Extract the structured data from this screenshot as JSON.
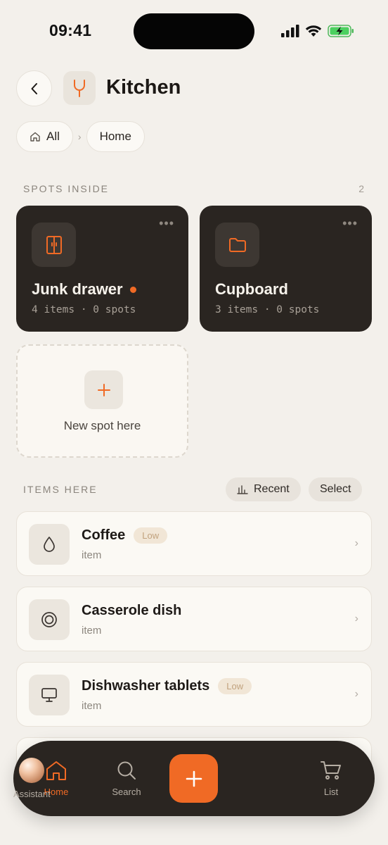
{
  "status_bar": {
    "time": "09:41"
  },
  "header": {
    "title": "Kitchen",
    "back_icon": "chevron-left-icon",
    "location_icon": "fork-icon"
  },
  "breadcrumb": {
    "items": [
      "All",
      "Home"
    ]
  },
  "spots_section": {
    "label": "SPOTS INSIDE",
    "count": "2",
    "spots": [
      {
        "name": "Junk drawer",
        "meta": "4 items · 0 spots",
        "icon": "cabinet-icon",
        "has_dot": true
      },
      {
        "name": "Cupboard",
        "meta": "3 items · 0 spots",
        "icon": "folder-icon",
        "has_dot": false
      }
    ],
    "new_spot_label": "New spot here"
  },
  "items_section": {
    "label": "ITEMS HERE",
    "recent_label": "Recent",
    "select_label": "Select",
    "items": [
      {
        "name": "Coffee",
        "sub": "item",
        "badge": "Low",
        "icon": "drop-icon"
      },
      {
        "name": "Casserole dish",
        "sub": "item",
        "badge": "",
        "icon": "target-icon"
      },
      {
        "name": "Dishwasher tablets",
        "sub": "item",
        "badge": "Low",
        "icon": "monitor-icon"
      }
    ]
  },
  "bottom_nav": {
    "home": "Home",
    "search": "Search",
    "assistant": "Assistant",
    "list": "List"
  },
  "colors": {
    "accent": "#f06a25",
    "dark": "#2a2521",
    "background": "#f3f0eb"
  }
}
